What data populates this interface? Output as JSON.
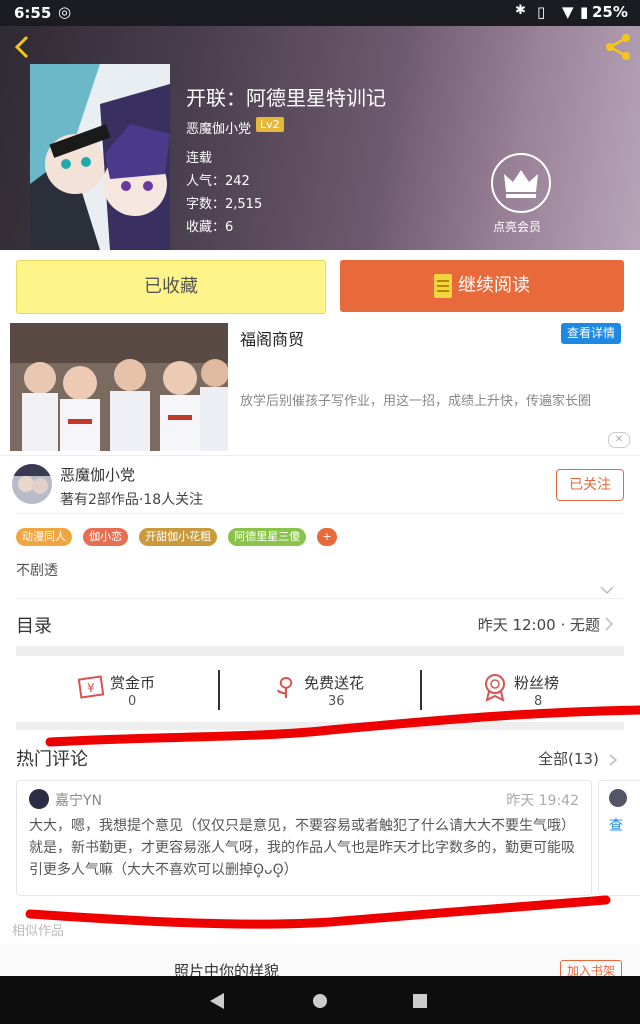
{
  "status_bar": {
    "time": "6:55",
    "battery": "25%"
  },
  "header": {
    "title": "开联：阿德里星特训记",
    "author": "恶魔伽小党",
    "level": "Lv2",
    "status": "连载",
    "popularity": "人气：242",
    "word_count": "字数：2,515",
    "favorites": "收藏：6",
    "vip_label": "点亮会员"
  },
  "actions": {
    "favorited": "已收藏",
    "continue_reading": "继续阅读"
  },
  "ad": {
    "title": "福阁商贸",
    "detail_button": "查看详情",
    "description": "放学后别催孩子写作业，用这一招，成绩上升快，传遍家长圈"
  },
  "author_card": {
    "name": "恶魔伽小党",
    "meta": "著有2部作品·18人关注",
    "follow_button": "已关注"
  },
  "tags": [
    {
      "label": "动漫同人",
      "color": "#f0a640"
    },
    {
      "label": "伽小恋",
      "color": "#e76f51"
    },
    {
      "label": "开甜伽小花粗",
      "color": "#c89a3a"
    },
    {
      "label": "阿德里星三傻",
      "color": "#8bc34a"
    }
  ],
  "synopsis": "不剧透",
  "toc": {
    "label": "目录",
    "latest": "昨天 12:00 · 无题"
  },
  "stats": [
    {
      "label": "赏金币",
      "value": "0",
      "icon": "reward-icon"
    },
    {
      "label": "免费送花",
      "value": "36",
      "icon": "flower-icon"
    },
    {
      "label": "粉丝榜",
      "value": "8",
      "icon": "medal-icon"
    }
  ],
  "comments": {
    "heading": "热门评论",
    "all": "全部(13)",
    "items": [
      {
        "user": "嘉宁YN",
        "time": "昨天 19:42",
        "text": "大大，嗯，我想提个意见（仅仅只是意见，不要容易或者触犯了什么请大大不要生气哦）就是，新书勤更，才更容易涨人气呀，我的作品人气也是昨天才比字数多的，勤更可能吸引更多人气嘛（大大不喜欢可以删掉ʘ̥ᴗʘ̥）"
      }
    ],
    "peek_text": "查"
  },
  "similar": {
    "heading": "相似作品",
    "book_title": "照片中你的样貌",
    "add_shelf": "加入书架"
  }
}
